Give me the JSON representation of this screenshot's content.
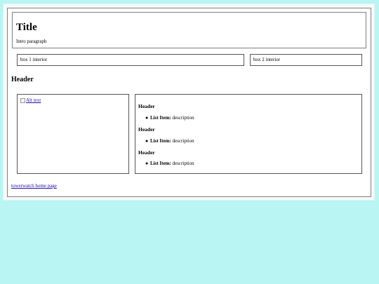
{
  "hero": {
    "title": "Title",
    "intro": "Intro paragraph"
  },
  "boxes": [
    {
      "text": "box 1 interior"
    },
    {
      "text": "box 2 interior"
    }
  ],
  "section": {
    "header": "Header"
  },
  "image_panel": {
    "alt_text": "Alt text",
    "icon": "broken-image-icon"
  },
  "list_panel": {
    "groups": [
      {
        "header": "Header",
        "item_label": "List Item:",
        "item_desc": "description"
      },
      {
        "header": "Header",
        "item_label": "List Item:",
        "item_desc": "description"
      },
      {
        "header": "Header",
        "item_label": "List Item:",
        "item_desc": "description"
      }
    ]
  },
  "footer": {
    "link_text": "towerwatch home page"
  },
  "colors": {
    "page_background": "#b8f5f3",
    "link": "#1a0dab",
    "border": "#808080"
  }
}
